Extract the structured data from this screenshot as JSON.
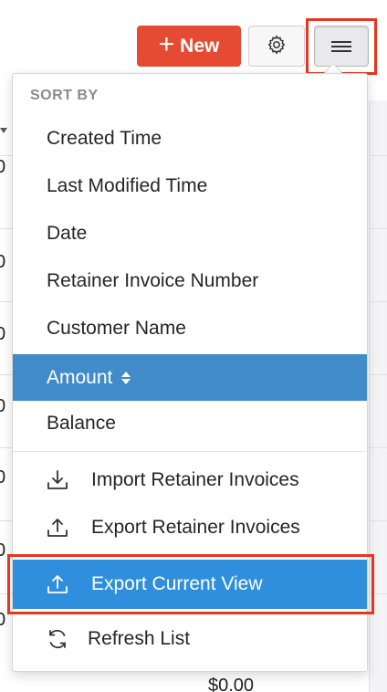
{
  "toolbar": {
    "new_label": "New",
    "new_color": "#e54b33"
  },
  "background": {
    "row_digits": [
      "0",
      "0",
      "0",
      "0",
      "0",
      "0",
      "0"
    ],
    "total_value": "$0.00"
  },
  "dropdown": {
    "sort_header": "SORT BY",
    "sort_options": [
      {
        "label": "Created Time"
      },
      {
        "label": "Last Modified Time"
      },
      {
        "label": "Date"
      },
      {
        "label": "Retainer Invoice Number"
      },
      {
        "label": "Customer Name"
      },
      {
        "label": "Amount",
        "active": true
      },
      {
        "label": "Balance"
      }
    ],
    "actions": [
      {
        "label": "Import Retainer Invoices",
        "icon": "import-icon"
      },
      {
        "label": "Export Retainer Invoices",
        "icon": "export-icon"
      },
      {
        "label": "Export Current View",
        "icon": "export-icon",
        "selected": true
      },
      {
        "label": "Refresh List",
        "icon": "refresh-icon"
      }
    ],
    "active_color": "#428bca",
    "selected_color": "#2f8fdc",
    "highlight_color": "#e8351f"
  }
}
